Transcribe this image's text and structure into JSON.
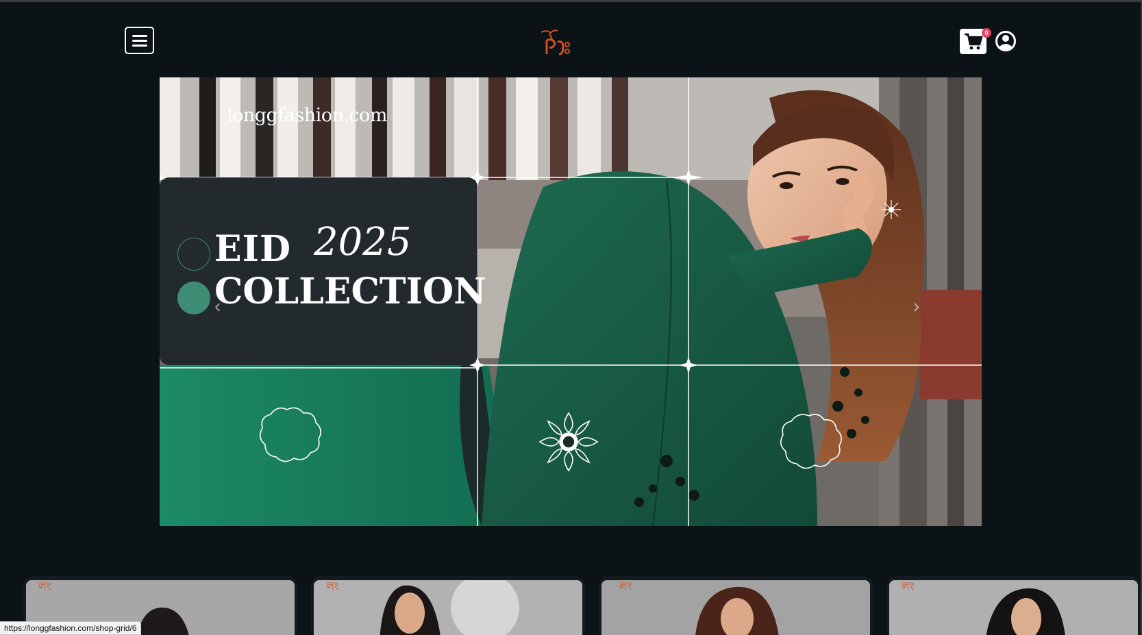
{
  "header": {
    "logo_alt": "লং",
    "cart_count": "0"
  },
  "hero": {
    "site_url": "longgfashion.com",
    "line1": "EID",
    "line2": "COLLECTION",
    "year": "2025",
    "prev_arrow": "‹",
    "next_arrow": "›"
  },
  "products": [
    {
      "logo": "লং"
    },
    {
      "logo": "লং"
    },
    {
      "logo": "লং"
    },
    {
      "logo": "লং"
    }
  ],
  "status_bar": {
    "url": "https://longgfashion.com/shop-grid/6"
  },
  "colors": {
    "background": "#0b1316",
    "accent_green": "#3e8c74",
    "logo_orange": "#d4521e",
    "badge": "#e8435c"
  }
}
